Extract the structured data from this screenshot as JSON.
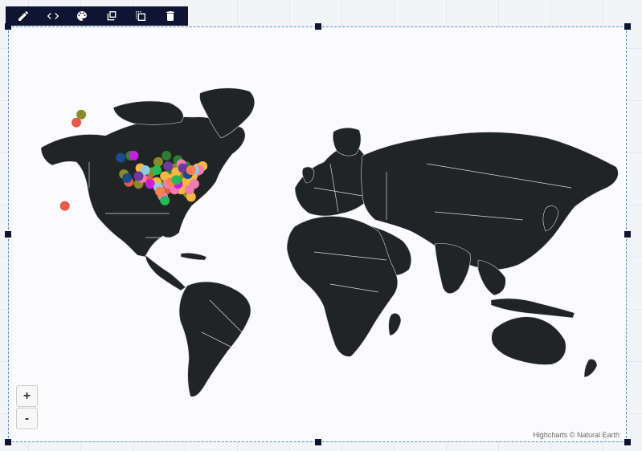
{
  "toolbar": {
    "buttons": [
      {
        "name": "edit",
        "icon": "pencil-icon"
      },
      {
        "name": "code",
        "icon": "code-icon"
      },
      {
        "name": "style",
        "icon": "palette-icon"
      },
      {
        "name": "duplicate",
        "icon": "duplicate-icon"
      },
      {
        "name": "select",
        "icon": "select-frame-icon"
      },
      {
        "name": "delete",
        "icon": "trash-icon"
      }
    ]
  },
  "map": {
    "land_color": "#202425",
    "border_color": "#d9d9d9",
    "background": "#fbfbfd",
    "zoom_in_label": "+",
    "zoom_out_label": "-",
    "credits": "Highcharts © Natural Earth"
  },
  "chart_data": {
    "type": "scatter",
    "projection": "world map",
    "series": [
      {
        "color": "#e8594a",
        "points": [
          [
            -150,
            61
          ],
          [
            -157,
            21
          ],
          [
            -118,
            34
          ],
          [
            -95,
            30
          ],
          [
            -84,
            39
          ],
          [
            -77,
            39
          ],
          [
            -106,
            35
          ]
        ]
      },
      {
        "color": "#8a8a2a",
        "points": [
          [
            -147,
            64
          ],
          [
            -121,
            38
          ],
          [
            -112,
            33
          ],
          [
            -100,
            44
          ],
          [
            -90,
            41
          ],
          [
            -82,
            28
          ],
          [
            -97,
            32
          ],
          [
            -87,
            36
          ],
          [
            -104,
            39
          ]
        ]
      },
      {
        "color": "#2e7d32",
        "points": [
          [
            -95,
            47
          ],
          [
            -88,
            45
          ],
          [
            -80,
            35
          ],
          [
            -98,
            27
          ],
          [
            -85,
            33
          ],
          [
            -93,
            38
          ],
          [
            -83,
            42
          ],
          [
            -117,
            47
          ]
        ]
      },
      {
        "color": "#f5b841",
        "points": [
          [
            -76,
            41
          ],
          [
            -73,
            42
          ],
          [
            -79,
            37
          ],
          [
            -80,
            26
          ],
          [
            -96,
            37
          ],
          [
            -101,
            34
          ],
          [
            -86,
            30
          ],
          [
            -91,
            36
          ],
          [
            -111,
            41
          ],
          [
            -89,
            39
          ],
          [
            -83,
            34
          ]
        ]
      },
      {
        "color": "#f27bb4",
        "points": [
          [
            -75,
            40
          ],
          [
            -78,
            33
          ],
          [
            -86,
            43
          ],
          [
            -94,
            33
          ],
          [
            -90,
            30
          ],
          [
            -97,
            26
          ],
          [
            -110,
            36
          ],
          [
            -81,
            30
          ]
        ]
      },
      {
        "color": "#1a4b8c",
        "points": [
          [
            -123,
            46
          ],
          [
            -119,
            36
          ],
          [
            -82,
            38
          ]
        ]
      },
      {
        "color": "#c71fe0",
        "points": [
          [
            -115,
            47
          ],
          [
            -105,
            33
          ],
          [
            -88,
            33
          ]
        ]
      },
      {
        "color": "#8ecae6",
        "points": [
          [
            -108,
            40
          ],
          [
            -100,
            31
          ],
          [
            -78,
            40
          ]
        ]
      },
      {
        "color": "#6a3d9a",
        "points": [
          [
            -112,
            37
          ],
          [
            -94,
            42
          ],
          [
            -85,
            41
          ]
        ]
      },
      {
        "color": "#ff7f50",
        "points": [
          [
            -92,
            34
          ],
          [
            -80,
            40
          ],
          [
            -99,
            29
          ]
        ]
      },
      {
        "color": "#22bb55",
        "points": [
          [
            -101,
            40
          ],
          [
            -96,
            24
          ],
          [
            -89,
            35
          ]
        ]
      }
    ]
  }
}
